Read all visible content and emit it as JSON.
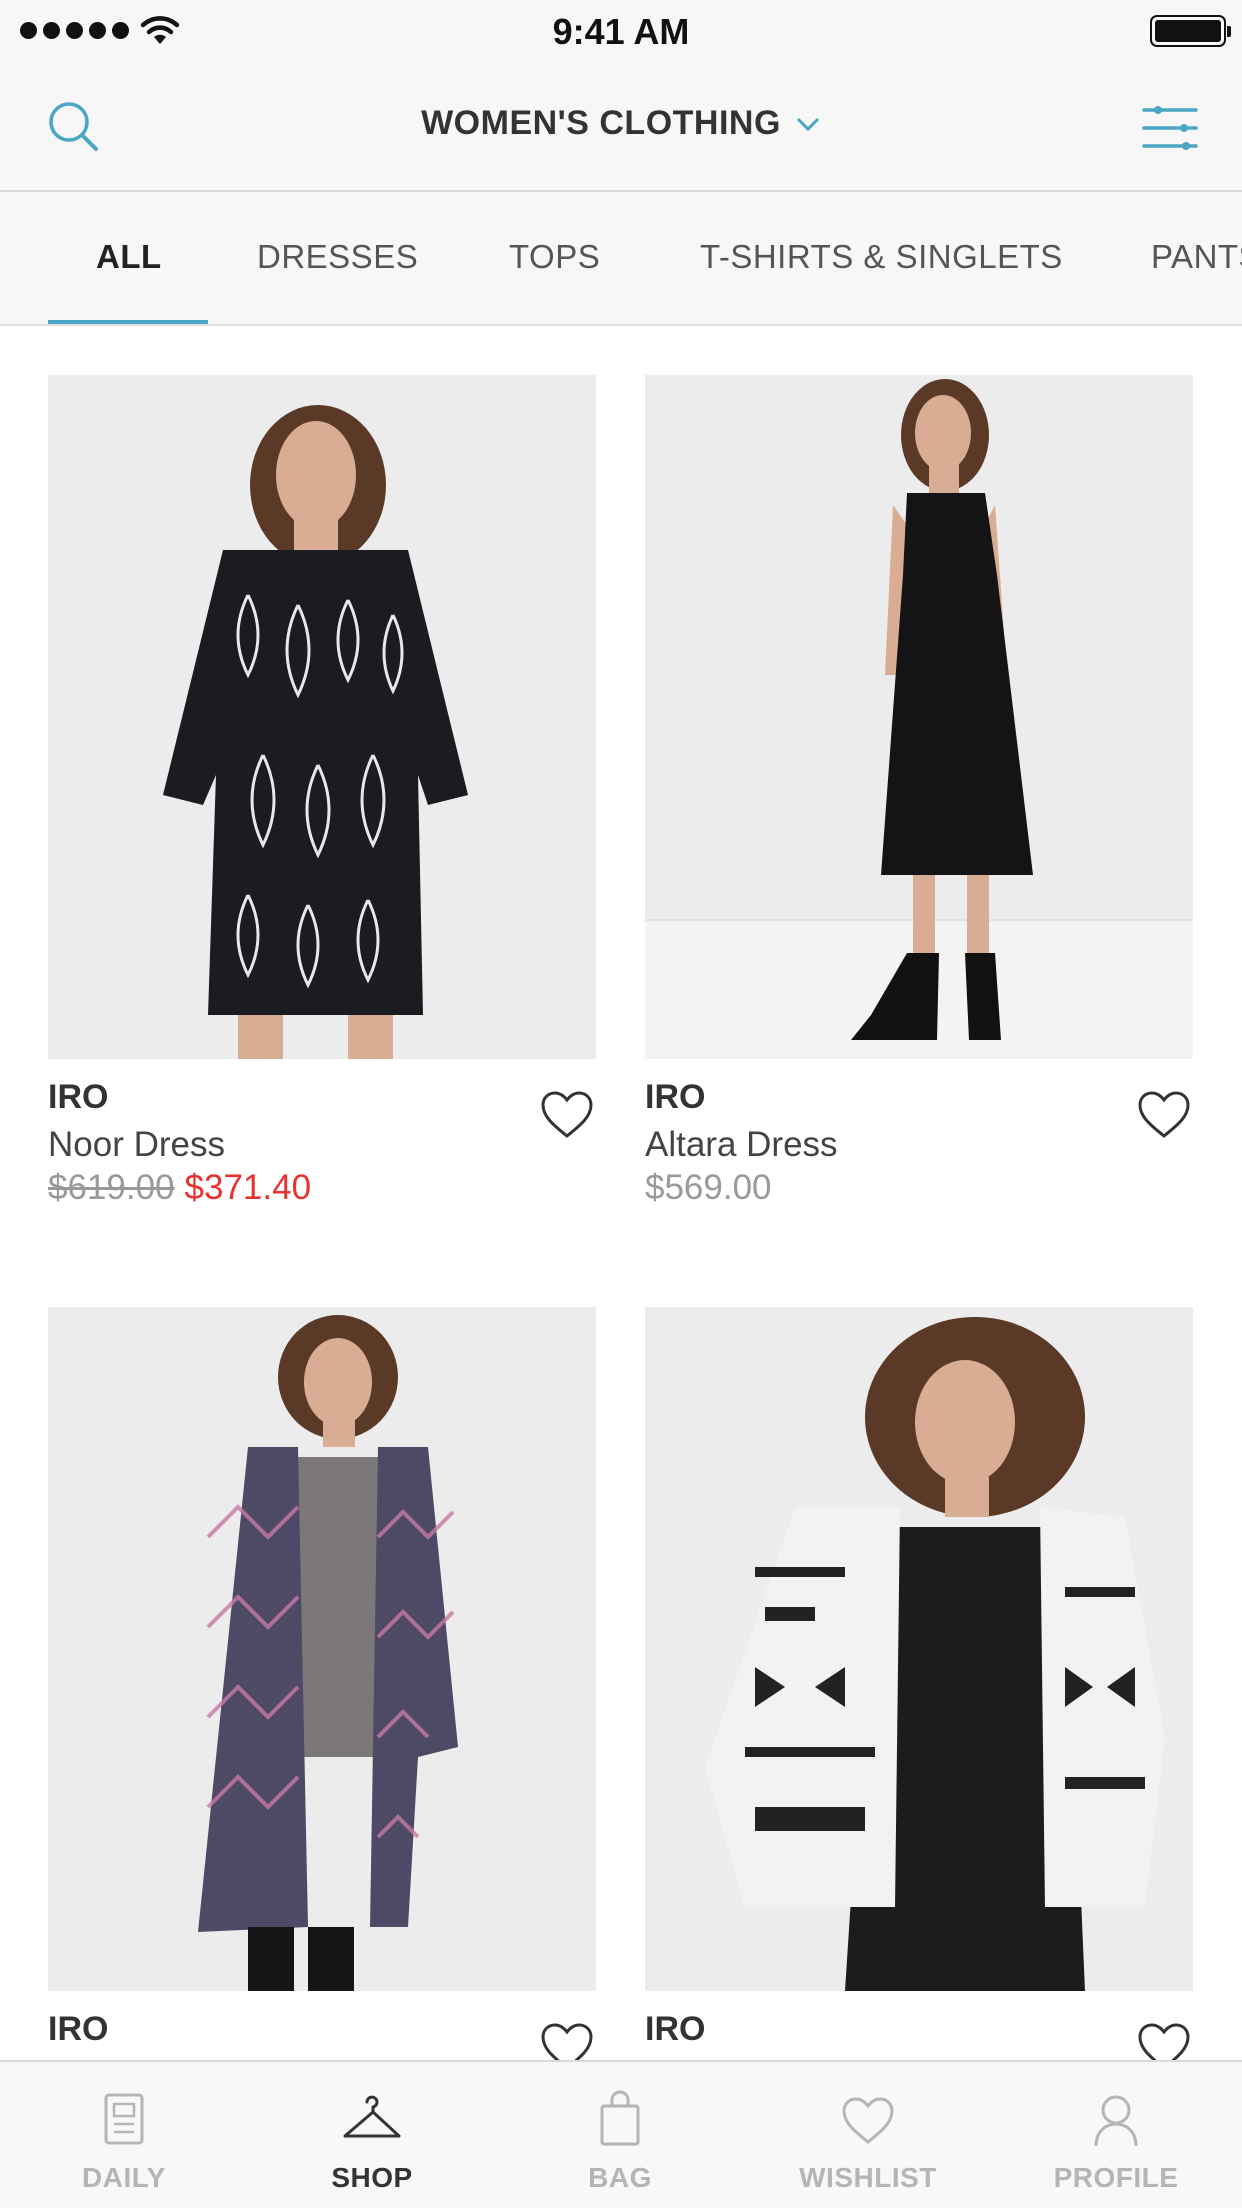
{
  "status_bar": {
    "time": "9:41 AM"
  },
  "header": {
    "title": "WOMEN'S CLOTHING",
    "accent_color": "#4aa6c4",
    "icons": {
      "left": "search-icon",
      "title_dropdown": "chevron-down-icon",
      "right": "filter-sliders-icon"
    }
  },
  "category_tabs": [
    {
      "label": "ALL",
      "active": true
    },
    {
      "label": "DRESSES",
      "active": false
    },
    {
      "label": "TOPS",
      "active": false
    },
    {
      "label": "T-SHIRTS & SINGLETS",
      "active": false
    },
    {
      "label": "PANTS",
      "active": false
    }
  ],
  "products": [
    {
      "brand": "IRO",
      "name": "Noor Dress",
      "old_price": "$619.00",
      "price": "$371.40",
      "on_sale": true
    },
    {
      "brand": "IRO",
      "name": "Altara Dress",
      "price": "$569.00",
      "on_sale": false
    },
    {
      "brand": "IRO"
    },
    {
      "brand": "IRO"
    }
  ],
  "tab_bar": [
    {
      "label": "DAILY",
      "icon": "newspaper-icon",
      "active": false
    },
    {
      "label": "SHOP",
      "icon": "hanger-icon",
      "active": true
    },
    {
      "label": "BAG",
      "icon": "shopping-bag-icon",
      "active": false
    },
    {
      "label": "WISHLIST",
      "icon": "heart-icon",
      "active": false
    },
    {
      "label": "PROFILE",
      "icon": "person-icon",
      "active": false
    }
  ],
  "colors": {
    "sale": "#e8322f",
    "muted": "#999999",
    "text": "#333333",
    "accent": "#4aa6c4"
  }
}
